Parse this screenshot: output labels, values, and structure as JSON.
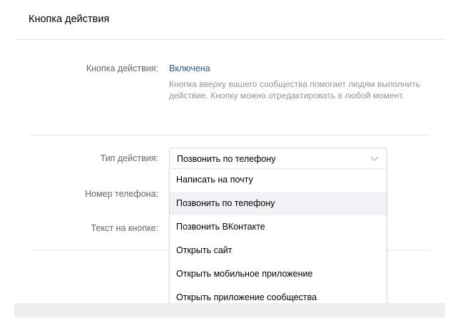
{
  "header": {
    "title": "Кнопка действия"
  },
  "form": {
    "action_button_label": "Кнопка действия:",
    "action_button_status": "Включена",
    "action_button_hint": "Кнопка вверху вашего сообщества помогает людям выполнить действие. Кнопку можно отредактировать в любой момент.",
    "action_type_label": "Тип действия:",
    "action_type_value": "Позвонить по телефону",
    "phone_label": "Номер телефона:",
    "button_text_label": "Текст на кнопке:"
  },
  "dropdown": {
    "options": [
      "Написать на почту",
      "Позвонить по телефону",
      "Позвонить ВКонтакте",
      "Открыть сайт",
      "Открыть мобильное приложение",
      "Открыть приложение сообщества"
    ],
    "selected": "Позвонить по телефону"
  },
  "icons": {
    "select_chevron": "chevron-down-icon"
  },
  "colors": {
    "link": "#2a5885",
    "label": "#656565",
    "hint": "#939393",
    "border": "#d3d9de",
    "selected_option_bg": "#f0f2f5",
    "page_bg": "#edeef0"
  }
}
